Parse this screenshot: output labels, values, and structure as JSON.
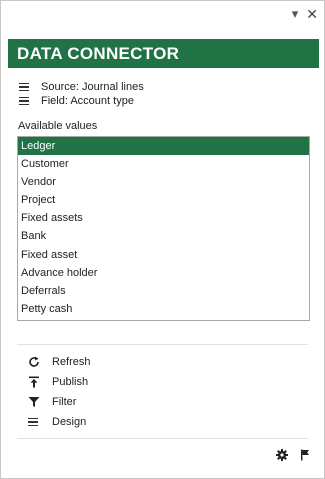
{
  "window": {
    "menu_glyph": "▾",
    "close_glyph": "✕"
  },
  "header": {
    "title": "DATA CONNECTOR",
    "color": "#217346"
  },
  "meta": {
    "source": "Source: Journal lines",
    "field": "Field: Account type"
  },
  "values": {
    "label": "Available values",
    "items": [
      "Ledger",
      "Customer",
      "Vendor",
      "Project",
      "Fixed assets",
      "Bank",
      "Fixed asset",
      "Advance holder",
      "Deferrals",
      "Petty cash"
    ],
    "selected": "Ledger"
  },
  "actions": [
    {
      "label": "Refresh",
      "icon": "refresh-icon"
    },
    {
      "label": "Publish",
      "icon": "publish-icon"
    },
    {
      "label": "Filter",
      "icon": "filter-icon"
    },
    {
      "label": "Design",
      "icon": "list-icon"
    }
  ],
  "footer": {
    "icons": [
      "gear-icon",
      "flag-icon"
    ]
  }
}
